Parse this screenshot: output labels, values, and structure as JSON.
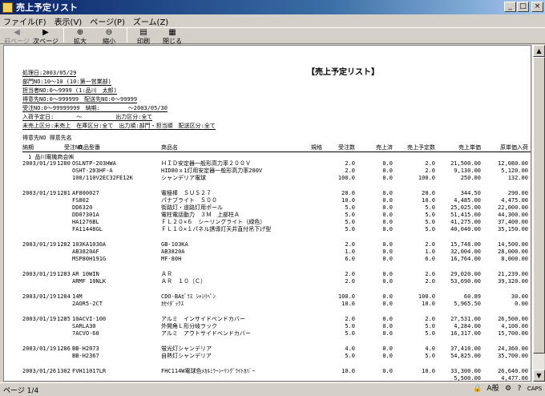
{
  "window": {
    "title": "売上予定リスト",
    "min": "_",
    "max": "□",
    "close": "×"
  },
  "menu": [
    "ファイル(F)",
    "表示(V)",
    "ページ(P)",
    "ズーム(Z)"
  ],
  "toolbar": [
    {
      "label": "前ページ",
      "icon": "◀",
      "disabled": true,
      "name": "prev-page-button"
    },
    {
      "label": "次ページ",
      "icon": "▶",
      "disabled": false,
      "name": "next-page-button"
    },
    {
      "label": "拡大",
      "icon": "⊕",
      "disabled": false,
      "name": "zoom-in-button"
    },
    {
      "label": "縮小",
      "icon": "⊖",
      "disabled": false,
      "name": "zoom-out-button"
    },
    {
      "label": "印刷",
      "icon": "▤",
      "disabled": false,
      "name": "print-button"
    },
    {
      "label": "閉じる",
      "icon": "▦",
      "disabled": false,
      "name": "close-button"
    }
  ],
  "report": {
    "title": "【売上予定リスト】",
    "header": [
      "処理日:2003/05/29",
      "部門NO:10～10 (10:第一営業部)",
      "担当者NO:0～9999 (1:品川　太郎)",
      "得意先NO:0～999999　配送先NO:0～99999",
      "受注NO:0～99999999　納期:　　　　　～2003/05/30",
      "入荷予定日:　　　　～　　　　　　出力区分:全て",
      "未売上区分:未売上　在庫区分:全て　出力順:部門・担当順　配送区分:全て"
    ],
    "colh1": "得意先NO 得意先名",
    "columns": {
      "nouki": "納期",
      "juchu": "受注NO",
      "code": "商品型番",
      "name": "商品名",
      "kikaku": "規格",
      "qty": "受注数",
      "sold": "売上済",
      "plan": "売上予定数",
      "price": "売上単価",
      "cost": "原単価入荷"
    },
    "customer": "1 品川電機商会㈱",
    "rows": [
      [
        "2003/01/19",
        "1280",
        "OSLNTP-203HWA",
        "ＨＩＤ安定器一般形高力率２００Ｖ",
        "",
        "2.0",
        "0.0",
        "2.0",
        "21,500.00",
        "12,080.00"
      ],
      [
        "",
        "",
        "OSHT-203HF-A",
        "HID80ｘ1灯用安定器一般形高力率200V",
        "",
        "2.0",
        "0.0",
        "2.0",
        "9,130.00",
        "5,120.00"
      ],
      [
        "",
        "",
        "100/110V2EC32FE12K",
        "シャンデリア電球",
        "",
        "100.0",
        "0.0",
        "100.0",
        "250.00",
        "132.00"
      ],
      null,
      [
        "2003/01/19",
        "1281",
        "AF800027",
        "電極棒　ＳＵＳ２７",
        "",
        "20.0",
        "0.0",
        "20.0",
        "344.50",
        "290.00"
      ],
      [
        "",
        "",
        "FS802",
        "パナブライト　５００",
        "",
        "10.0",
        "0.0",
        "10.0",
        "4,485.00",
        "4,475.00"
      ],
      [
        "",
        "",
        "DD6320",
        "街路灯・道路灯用ポール",
        "",
        "5.0",
        "0.0",
        "5.0",
        "25,025.00",
        "22,000.00"
      ],
      [
        "",
        "",
        "DD07301A",
        "電柱電話動力　３Ｍ　上部柱Ａ",
        "",
        "5.0",
        "0.0",
        "5.0",
        "51,415.00",
        "44,300.00"
      ],
      [
        "",
        "",
        "HA1276BL",
        "ＦＬ２０×６　シーリングライト（緑色）",
        "",
        "5.0",
        "0.0",
        "5.0",
        "41,275.00",
        "37,400.00"
      ],
      [
        "",
        "",
        "FA11448GL",
        "ＦＬ１０×１パネル誘導灯天井直付吊下げ型",
        "",
        "5.0",
        "0.0",
        "5.0",
        "40,040.00",
        "35,150.00"
      ],
      null,
      [
        "2003/01/19",
        "1282",
        "103KA1030A",
        "GB-103KA",
        "",
        "2.0",
        "0.0",
        "2.0",
        "15,748.00",
        "14,500.00"
      ],
      [
        "",
        "",
        "AB3820AF",
        "AB3820A",
        "",
        "1.0",
        "0.0",
        "1.0",
        "32,004.00",
        "28,000.00"
      ],
      [
        "",
        "",
        "MSP80H191G",
        "MF-80H",
        "",
        "6.0",
        "0.0",
        "6.0",
        "16,764.00",
        "8,000.00"
      ],
      null,
      [
        "2003/01/19",
        "1283",
        "AR 10WIN",
        "ＡＲ",
        "",
        "2.0",
        "0.0",
        "2.0",
        "29,020.00",
        "21,239.00"
      ],
      [
        "",
        "",
        "ARMF 10NLK",
        "ＡＲ　１０（Ｃ）",
        "",
        "2.0",
        "0.0",
        "2.0",
        "53,690.00",
        "39,320.00"
      ],
      null,
      [
        "2003/01/19",
        "1284",
        "14M",
        "CDO-BAｶﾞﾗｽ ｼｬｼﾘﾍﾟﾝ",
        "",
        "100.0",
        "0.0",
        "100.0",
        "60.89",
        "30.00"
      ],
      [
        "",
        "",
        "2AOR5-2CT",
        "ｶｾｲﾀﾞｯｸｽ",
        "",
        "10.0",
        "0.0",
        "10.0",
        "5,965.50",
        "0.00"
      ],
      null,
      [
        "2003/01/19",
        "1285",
        "10ACVI-100",
        "アルミ　インサイドベンドカバー",
        "",
        "2.0",
        "0.0",
        "2.0",
        "27,531.00",
        "26,500.00"
      ],
      [
        "",
        "",
        "SARLA30",
        "外開角Ｌ形分岐ラック",
        "",
        "5.0",
        "0.0",
        "5.0",
        "4,284.00",
        "4,100.00"
      ],
      [
        "",
        "",
        "7ACVO-60",
        "アルミ　アウトサイドベンドカバー",
        "",
        "5.0",
        "0.0",
        "5.0",
        "16,317.00",
        "15,700.00"
      ],
      null,
      [
        "2003/01/19",
        "1286",
        "BB-H2073",
        "蛍光灯シャンデリア",
        "",
        "4.0",
        "0.0",
        "4.0",
        "37,410.00",
        "24,360.00"
      ],
      [
        "",
        "",
        "BB-H2367",
        "自熱灯シャンデリア",
        "",
        "5.0",
        "0.0",
        "5.0",
        "54,825.00",
        "35,700.00"
      ],
      null,
      [
        "2003/01/26",
        "1302",
        "FVH11017LR",
        "FHC114W電球色ﾒｶﾙﾐﾗｰｼｰﾘﾝｸﾞﾗｲﾄｶﾊﾞｰ",
        "",
        "10.0",
        "0.0",
        "10.0",
        "33,300.00",
        "26,640.00"
      ],
      [
        "",
        "",
        "",
        "",
        "",
        "",
        "",
        "",
        "5,500.00",
        "4,477.00"
      ]
    ]
  },
  "status": {
    "page": "ページ 1/4"
  },
  "tray": [
    "🔒",
    "A般",
    "⚙",
    "?",
    "CAPS"
  ]
}
